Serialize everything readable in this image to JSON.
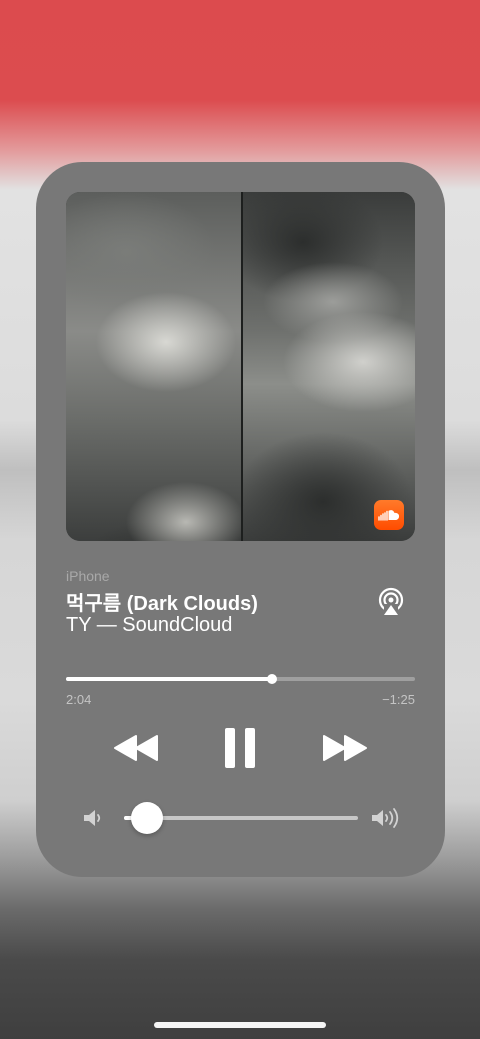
{
  "now_playing": {
    "device": "iPhone",
    "title": "먹구름 (Dark Clouds)",
    "artist_line": "TY — SoundCloud",
    "source_badge_icon": "soundcloud-icon",
    "artwork_icon": "album-artwork"
  },
  "progress": {
    "elapsed": "2:04",
    "remaining": "−1:25",
    "fraction": 0.59
  },
  "controls": {
    "rewind_icon": "rewind-icon",
    "pause_icon": "pause-icon",
    "forward_icon": "fast-forward-icon",
    "airplay_icon": "airplay-icon"
  },
  "volume": {
    "level": 0.1,
    "low_icon": "volume-low-icon",
    "high_icon": "volume-high-icon"
  },
  "colors": {
    "background_top": "#dc4b4e",
    "card": "#787878",
    "accent_soundcloud": "#ff5500",
    "text_primary": "#ffffff",
    "text_secondary": "#a9a9a9"
  }
}
